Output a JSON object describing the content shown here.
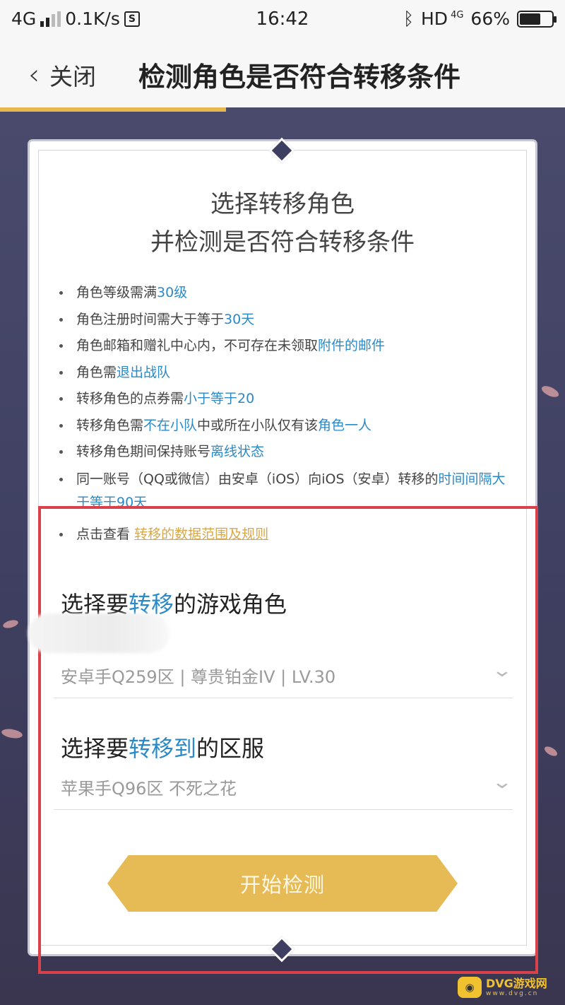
{
  "status_bar": {
    "network": "4G",
    "speed": "0.1K/s",
    "time": "16:42",
    "hd": "HD",
    "hd_network": "4G",
    "battery": "66%",
    "battery_level": 0.66
  },
  "nav": {
    "close_label": "关闭",
    "title": "检测角色是否符合转移条件"
  },
  "card": {
    "title_line1": "选择转移角色",
    "title_line2": "并检测是否符合转移条件",
    "rules": [
      {
        "text": "角色等级需满",
        "highlight": "30级",
        "after": ""
      },
      {
        "text": "角色注册时间需大于等于",
        "highlight": "30天",
        "after": ""
      },
      {
        "text": "角色邮箱和赠礼中心内，不可存在未领取",
        "highlight": "附件的邮件",
        "after": ""
      },
      {
        "text": "角色需",
        "highlight": "退出战队",
        "after": ""
      },
      {
        "text": "转移角色的点券需",
        "highlight": "小于等于20",
        "after": ""
      },
      {
        "text": "转移角色需",
        "highlight": "不在小队",
        "after": "中或所在小队仅有该",
        "highlight2": "角色一人"
      },
      {
        "text": "转移角色期间保持账号",
        "highlight": "离线状态",
        "after": ""
      },
      {
        "text": "同一账号（QQ或微信）由安卓（iOS）向iOS（安卓）转移的",
        "highlight": "时间间隔大于等于90天",
        "after": ""
      }
    ],
    "view_prefix": "点击查看",
    "view_link": "转移的数据范围及规则"
  },
  "role_section": {
    "label_prefix": "选择要",
    "label_highlight": "转移",
    "label_suffix": "的游戏角色",
    "value": "安卓手Q259区 | 尊贵铂金IV | LV.30"
  },
  "server_section": {
    "label_prefix": "选择要",
    "label_highlight": "转移到",
    "label_suffix": "的区服",
    "value": "苹果手Q96区 不死之花"
  },
  "start_button": "开始检测",
  "watermark": {
    "main": "DVG游戏网",
    "sub": "www.dvg.cn"
  },
  "colors": {
    "accent_blue": "#2a8ac8",
    "gold": "#e6bb55",
    "frame_red": "#d9424a",
    "background": "#4a4b6c"
  }
}
